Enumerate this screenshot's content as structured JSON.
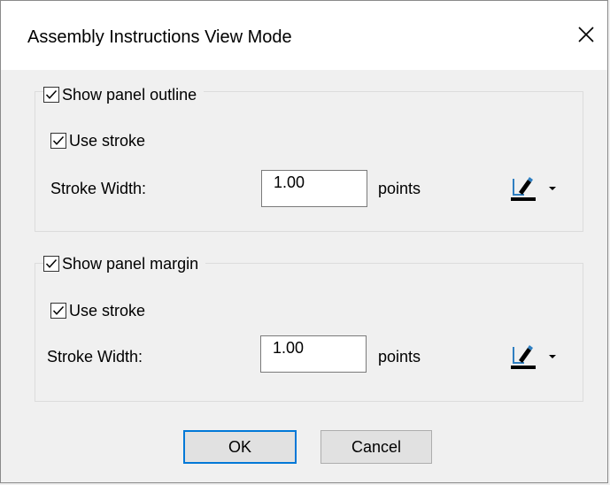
{
  "dialog": {
    "title": "Assembly Instructions View Mode",
    "close_icon": "close-icon"
  },
  "outline_group": {
    "label": "Show panel outline",
    "checked": true,
    "use_stroke": {
      "label": "Use stroke",
      "checked": true
    },
    "stroke_width_label": "Stroke Width:",
    "stroke_width_value": "1.00",
    "units": "points",
    "color_icon": "pen-color-icon",
    "dropdown_icon": "dropdown-arrow-icon"
  },
  "margin_group": {
    "label": "Show panel margin",
    "checked": true,
    "use_stroke": {
      "label": "Use stroke",
      "checked": true
    },
    "stroke_width_label": "Stroke Width:",
    "stroke_width_value": "1.00",
    "units": "points",
    "color_icon": "pen-color-icon",
    "dropdown_icon": "dropdown-arrow-icon"
  },
  "buttons": {
    "ok": "OK",
    "cancel": "Cancel"
  },
  "colors": {
    "default_button_border": "#0078d7",
    "dialog_background": "#f0f0f0",
    "pen_swatch": "#000000",
    "pen_accent": "#2f7fc1"
  }
}
